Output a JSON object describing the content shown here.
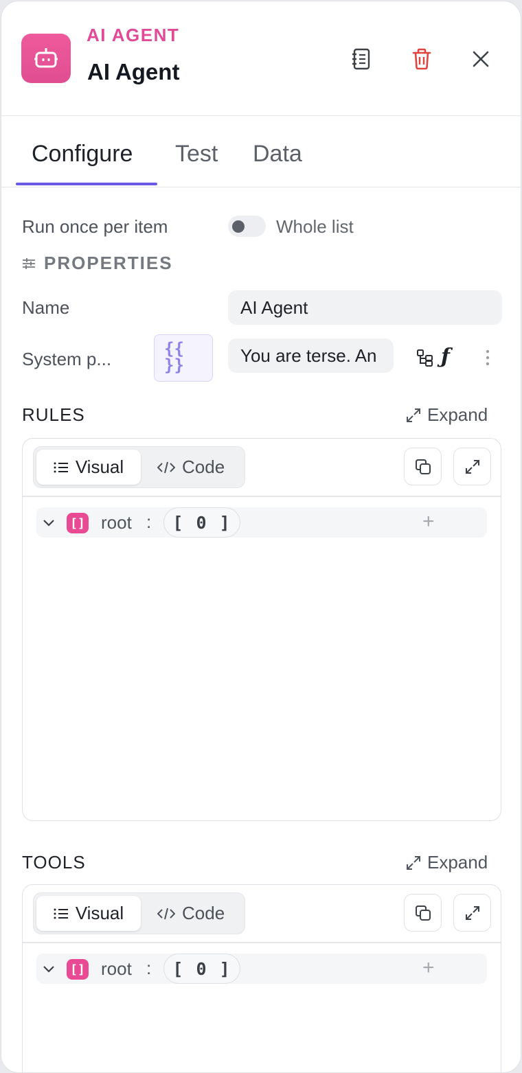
{
  "header": {
    "kicker": "AI AGENT",
    "title": "AI Agent",
    "icon": "robot-icon",
    "accent": "#e04a96",
    "danger": "#e0443e"
  },
  "tabs": [
    {
      "label": "Configure",
      "active": true
    },
    {
      "label": "Test",
      "active": false
    },
    {
      "label": "Data",
      "active": false
    }
  ],
  "mode": {
    "label": "Run once per item",
    "toggle_label": "Whole list",
    "toggle_on": false
  },
  "properties": {
    "title": "PROPERTIES",
    "name_label": "Name",
    "name_value": "AI Agent",
    "system_label": "System p...",
    "braces": "{{ }}",
    "system_value": "You are terse. An"
  },
  "rules": {
    "title": "RULES",
    "expand": "Expand",
    "visual_tab": "Visual",
    "code_tab": "Code",
    "root_key": "root",
    "colon": ":",
    "count": "[ 0 ]"
  },
  "tools": {
    "title": "TOOLS",
    "expand": "Expand",
    "visual_tab": "Visual",
    "code_tab": "Code",
    "root_key": "root",
    "colon": ":",
    "count": "[ 0 ]"
  },
  "colors": {
    "tab_underline": "#6a5be6",
    "badge": "#e84a94",
    "braces": "#8e82e8"
  }
}
